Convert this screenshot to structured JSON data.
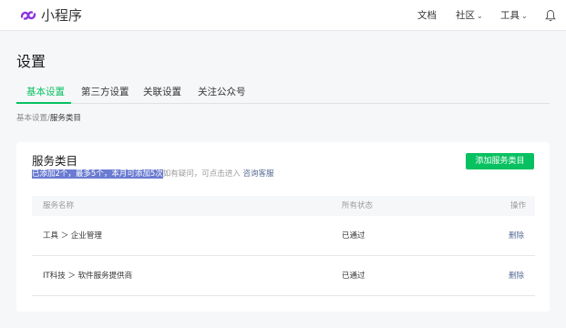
{
  "brand": {
    "name": "小程序"
  },
  "topnav": {
    "docs": "文档",
    "community": "社区",
    "tools": "工具"
  },
  "page": {
    "title": "设置",
    "tabs": [
      {
        "label": "基本设置"
      },
      {
        "label": "第三方设置"
      },
      {
        "label": "关联设置"
      },
      {
        "label": "关注公众号"
      }
    ],
    "breadcrumb": {
      "parent": "基本设置",
      "current": "服务类目"
    }
  },
  "card": {
    "title": "服务类目",
    "desc_highlight": "已添加2个，最多5个，本月可添加5次",
    "desc_rest": "如有疑问，可点击进入",
    "desc_link": "咨询客服",
    "add_button": "添加服务类目",
    "columns": {
      "name": "服务名称",
      "status": "所有状态",
      "op": "操作"
    },
    "rows": [
      {
        "name": "工具 ＞ 企业管理",
        "status": "已通过",
        "op": "删除"
      },
      {
        "name": "IT科技 ＞ 软件服务提供商",
        "status": "已通过",
        "op": "删除"
      }
    ]
  },
  "colors": {
    "accent": "#07c160",
    "link": "#576b95",
    "brand": "#8b35e0"
  }
}
